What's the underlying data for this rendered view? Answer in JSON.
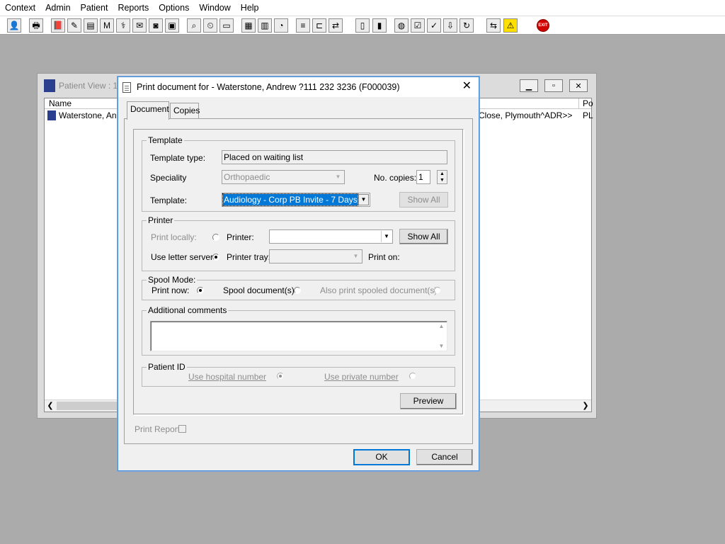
{
  "menu": [
    "Context",
    "Admin",
    "Patient",
    "Reports",
    "Options",
    "Window",
    "Help"
  ],
  "toolbar": {
    "exit_label": "EXIT"
  },
  "bg_window": {
    "title": "Patient View : 1",
    "col_name": "Name",
    "col_po": "Po",
    "row_name": "Waterstone, Andr",
    "row_address": "Close, Plymouth^ADR>>",
    "row_po": "PL"
  },
  "dialog": {
    "title": "Print document for - Waterstone, Andrew ?111 232 3236 (F000039)",
    "tabs": [
      "Document",
      "Copies"
    ],
    "template": {
      "legend": "Template",
      "type_label": "Template type:",
      "type_value": "Placed on waiting list",
      "speciality_label": "Speciality",
      "speciality_value": "Orthopaedic",
      "copies_label": "No. copies:",
      "copies_value": "1",
      "template_label": "Template:",
      "template_value": "Audiology - Corp PB Invite - 7 Days",
      "show_all": "Show All"
    },
    "printer": {
      "legend": "Printer",
      "print_locally": "Print locally:",
      "printer_label": "Printer:",
      "printer_value": "",
      "show_all": "Show All",
      "use_letter_server": "Use letter server:",
      "printer_tray": "Printer tray:",
      "print_on": "Print on:"
    },
    "spool": {
      "legend": "Spool Mode:",
      "print_now": "Print now:",
      "spool_docs": "Spool document(s)",
      "also_print": "Also print spooled document(s)"
    },
    "comments": {
      "legend": "Additional comments",
      "value": ""
    },
    "patient_id": {
      "legend": "Patient ID",
      "hospital": "Use hospital number",
      "private": "Use private number"
    },
    "preview": "Preview",
    "print_report": "Print Report",
    "ok": "OK",
    "cancel": "Cancel"
  }
}
